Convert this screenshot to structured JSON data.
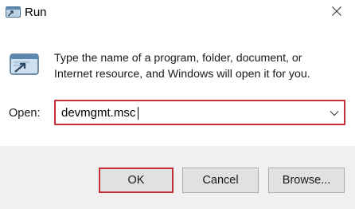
{
  "window": {
    "title": "Run",
    "icon": "run-icon",
    "close_icon": "close-icon"
  },
  "body": {
    "icon": "run-icon",
    "description": "Type the name of a program, folder, document, or Internet resource, and Windows will open it for you."
  },
  "open_field": {
    "label": "Open:",
    "value": "devmgmt.msc",
    "dropdown_icon": "chevron-down-icon",
    "highlight_color": "#c72d3a"
  },
  "buttons": {
    "ok": "OK",
    "cancel": "Cancel",
    "browse": "Browse...",
    "ok_highlight_color": "#c72d3a"
  }
}
